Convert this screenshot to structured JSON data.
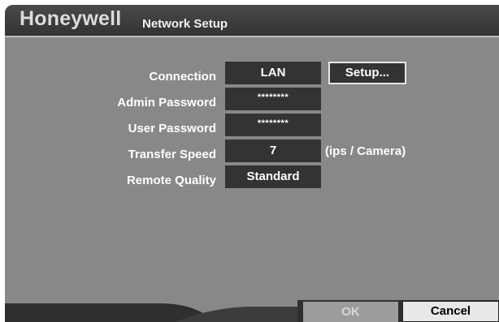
{
  "header": {
    "brand": "Honeywell",
    "title": "Network Setup"
  },
  "form": {
    "connection": {
      "label": "Connection",
      "value": "LAN",
      "setup_label": "Setup..."
    },
    "admin_password": {
      "label": "Admin Password",
      "value": "********"
    },
    "user_password": {
      "label": "User Password",
      "value": "********"
    },
    "transfer_speed": {
      "label": "Transfer Speed",
      "value": "7",
      "unit": "(ips / Camera)"
    },
    "remote_quality": {
      "label": "Remote Quality",
      "value": "Standard"
    }
  },
  "footer": {
    "ok_label": "OK",
    "cancel_label": "Cancel"
  },
  "colors": {
    "background": "#888888",
    "titlebar": "#3a3a3a",
    "field": "#333333",
    "bottom_bar": "#2f2f2f",
    "cancel_button": "#e8e8e8"
  }
}
